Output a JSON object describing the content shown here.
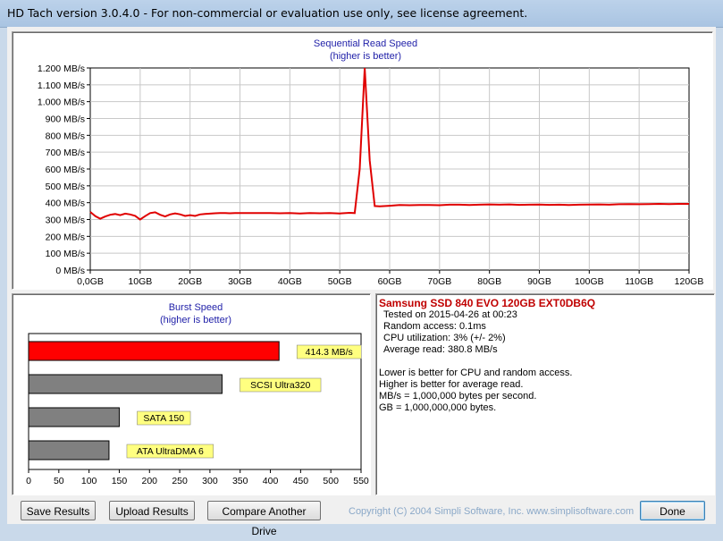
{
  "window": {
    "title": "HD Tach version 3.0.4.0  - For non-commercial or evaluation use only, see license agreement."
  },
  "colors": {
    "line": "#e00000",
    "bar_highlight": "#ff0000",
    "bar_other": "#808080",
    "label_bg": "#ffff80",
    "drive_name": "#c00000"
  },
  "chart_data": [
    {
      "type": "line",
      "title": "Sequential Read Speed",
      "subtitle": "(higher is better)",
      "xlabel": "",
      "ylabel": "",
      "xlim": [
        0,
        120
      ],
      "ylim": [
        0,
        1200
      ],
      "x_ticks": [
        "0,0GB",
        "10GB",
        "20GB",
        "30GB",
        "40GB",
        "50GB",
        "60GB",
        "70GB",
        "80GB",
        "90GB",
        "100GB",
        "110GB",
        "120GB"
      ],
      "y_ticks": [
        "0 MB/s",
        "100 MB/s",
        "200 MB/s",
        "300 MB/s",
        "400 MB/s",
        "500 MB/s",
        "600 MB/s",
        "700 MB/s",
        "800 MB/s",
        "900 MB/s",
        "1.000 MB/s",
        "1.100 MB/s",
        "1.200 MB/s"
      ],
      "grid": true,
      "series": [
        {
          "x": [
            0,
            1,
            2,
            3,
            4,
            5,
            6,
            7,
            8,
            9,
            10,
            11,
            12,
            13,
            14,
            15,
            16,
            17,
            18,
            19,
            20,
            21,
            22,
            23,
            24,
            25,
            26,
            27,
            28,
            29,
            30,
            32,
            34,
            36,
            38,
            40,
            42,
            44,
            46,
            48,
            50,
            52,
            53,
            54,
            55,
            56,
            57,
            58,
            60,
            62,
            64,
            66,
            68,
            70,
            72,
            74,
            76,
            78,
            80,
            82,
            84,
            86,
            88,
            90,
            92,
            94,
            96,
            98,
            100,
            102,
            104,
            106,
            108,
            110,
            112,
            114,
            116,
            118,
            120
          ],
          "y": [
            345,
            320,
            305,
            318,
            328,
            333,
            326,
            335,
            330,
            322,
            300,
            320,
            338,
            343,
            328,
            318,
            330,
            336,
            331,
            321,
            326,
            321,
            330,
            333,
            335,
            337,
            338,
            339,
            337,
            338,
            339,
            339,
            338,
            339,
            337,
            338,
            336,
            338,
            337,
            339,
            336,
            340,
            338,
            600,
            1200,
            650,
            380,
            378,
            382,
            386,
            385,
            386,
            386,
            385,
            388,
            388,
            386,
            388,
            390,
            388,
            390,
            387,
            388,
            389,
            387,
            388,
            386,
            388,
            389,
            390,
            388,
            391,
            392,
            391,
            392,
            393,
            392,
            393,
            393
          ]
        }
      ]
    },
    {
      "type": "bar",
      "title": "Burst Speed",
      "subtitle": "(higher is better)",
      "categories": [
        "414.3 MB/s",
        "SCSI Ultra320",
        "SATA 150",
        "ATA UltraDMA 6"
      ],
      "values": [
        414.3,
        320,
        150,
        133
      ],
      "xlim": [
        0,
        550
      ],
      "x_ticks": [
        "0",
        "50",
        "100",
        "150",
        "200",
        "250",
        "300",
        "350",
        "400",
        "450",
        "500",
        "550"
      ]
    }
  ],
  "info": {
    "drive": "Samsung SSD 840 EVO 120GB EXT0DB6Q",
    "tested": "Tested on 2015-04-26 at 00:23",
    "random_access": "Random access: 0.1ms",
    "cpu": "CPU utilization: 3% (+/- 2%)",
    "avg_read": "Average read: 380.8 MB/s",
    "note1": "Lower is better for CPU and random access.",
    "note2": "Higher is better for average read.",
    "note3": "MB/s = 1,000,000 bytes per second.",
    "note4": "GB = 1,000,000,000 bytes."
  },
  "buttons": {
    "save": "Save Results",
    "upload": "Upload Results",
    "compare": "Compare Another Drive",
    "done": "Done"
  },
  "copyright": "Copyright (C) 2004 Simpli Software, Inc. www.simplisoftware.com"
}
